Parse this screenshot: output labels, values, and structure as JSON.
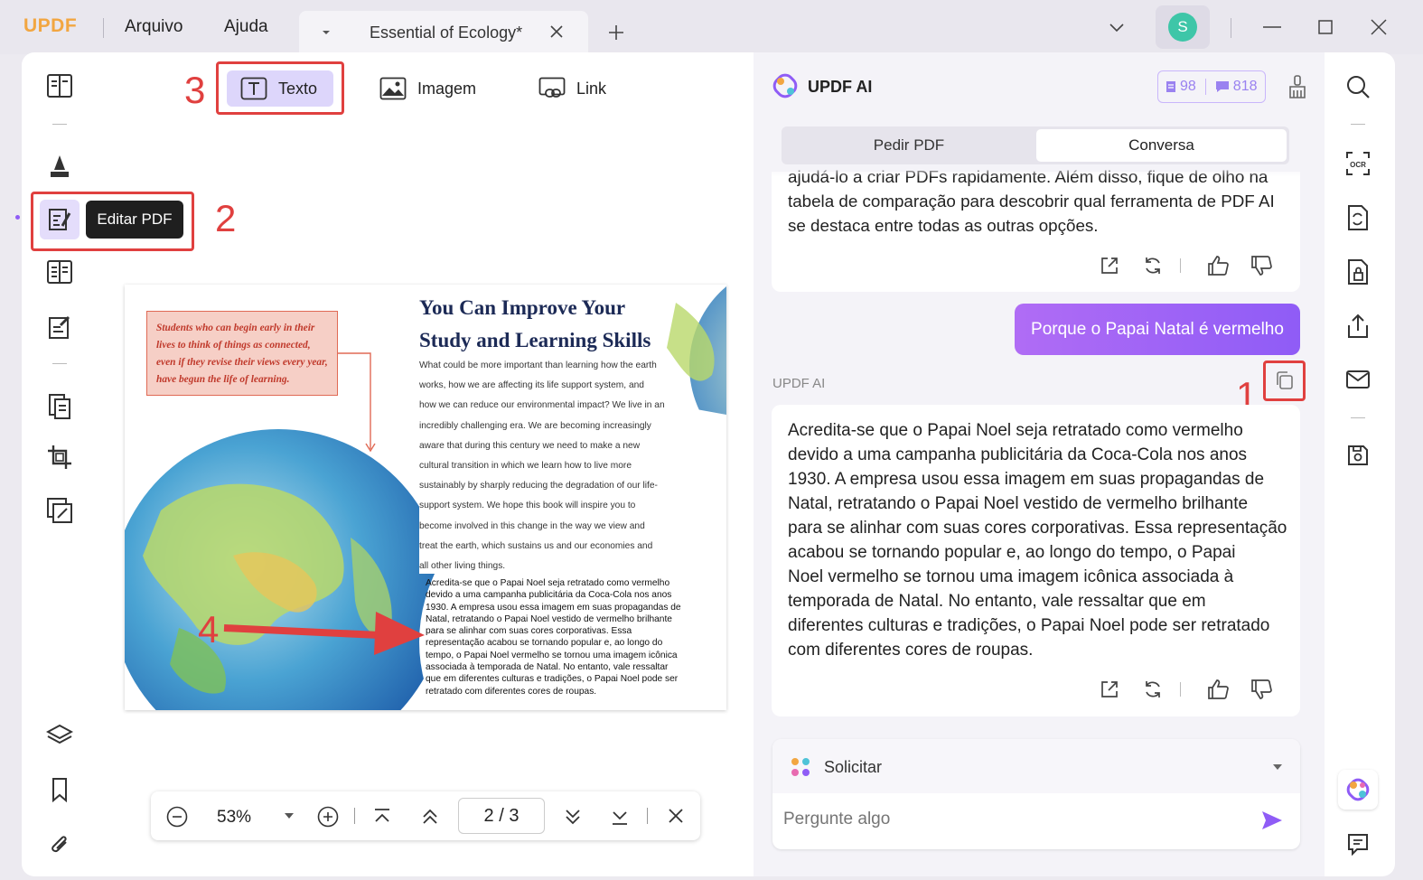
{
  "app": {
    "logo": "UPDF",
    "menus": [
      "Arquivo",
      "Ajuda"
    ],
    "user_initial": "S"
  },
  "tab": {
    "title": "Essential of Ecology*"
  },
  "toolbar": {
    "texto": "Texto",
    "imagem": "Imagem",
    "link": "Link"
  },
  "tooltip": "Editar PDF",
  "annotations": {
    "n1": "1",
    "n2": "2",
    "n3": "3",
    "n4": "4"
  },
  "document": {
    "quote": "Students who can begin early in their lives to think of things as connected, even if they revise their views every year, have begun the life of learning.",
    "title_line1": "You Can Improve Your",
    "title_line2": "Study and Learning Skills",
    "body_lines": [
      "What could be more important than learning how the earth",
      "works, how we are affecting its life support system, and",
      "how we can reduce our environmental impact? We live in an",
      "incredibly challenging era. We are becoming increasingly",
      "aware that during this century we need to make a new",
      "cultural transition in which we learn how to live more",
      "sustainably by sharply reducing the degradation of our life-",
      "support system. We hope this book will inspire you to",
      "become involved in this change in the way we view and",
      "treat the earth, which sustains us and our economies and",
      "all other living things."
    ],
    "inserted_lines": [
      "Acredita-se que o Papai Noel seja retratado como vermelho",
      "devido a uma campanha publicitária da Coca-Cola nos anos",
      "1930. A empresa usou essa imagem em suas propagandas de",
      "Natal, retratando o Papai Noel vestido de vermelho brilhante",
      "para se alinhar com suas cores corporativas. Essa",
      "representação acabou se tornando popular e, ao longo do",
      "tempo, o Papai Noel vermelho se tornou uma imagem icônica",
      "associada à temporada de Natal. No entanto, vale ressaltar",
      "que em diferentes culturas e tradições, o Papai Noel pode ser",
      "retratado com diferentes cores de roupas."
    ]
  },
  "zoom": {
    "level": "53%",
    "page": "2 / 3",
    "page_progress": 0.667
  },
  "ai": {
    "title": "UPDF AI",
    "badge1": "98",
    "badge2": "818",
    "tabs": [
      "Pedir PDF",
      "Conversa"
    ],
    "prev_lines": [
      "ajudá-lo a criar PDFs rapidamente. Além disso, fique de olho na",
      "tabela de comparação para descobrir qual ferramenta de PDF AI",
      "se destaca entre todas as outras opções."
    ],
    "user_message": "Porque o Papai Natal é vermelho",
    "ai_label": "UPDF AI",
    "answer_lines": [
      "Acredita-se que o Papai Noel seja retratado como vermelho",
      "devido a uma campanha publicitária da Coca-Cola nos anos",
      "1930. A empresa usou essa imagem em suas propagandas de",
      "Natal, retratando o Papai Noel vestido de vermelho brilhante",
      "para se alinhar com suas cores corporativas. Essa representação",
      "acabou se tornando popular e, ao longo do tempo, o Papai",
      "Noel vermelho se tornou uma imagem icônica associada à",
      "temporada de Natal. No entanto, vale ressaltar que em",
      "diferentes culturas e tradições, o Papai Noel pode ser retratado",
      "com diferentes cores de roupas."
    ],
    "prompt_label": "Solicitar",
    "input_placeholder": "Pergunte algo"
  },
  "colors": {
    "accent": "#8f5cf6",
    "annotation_red": "#e0403f",
    "brand_blue": "#5b5bd6",
    "brand_orange": "#f2a641"
  }
}
